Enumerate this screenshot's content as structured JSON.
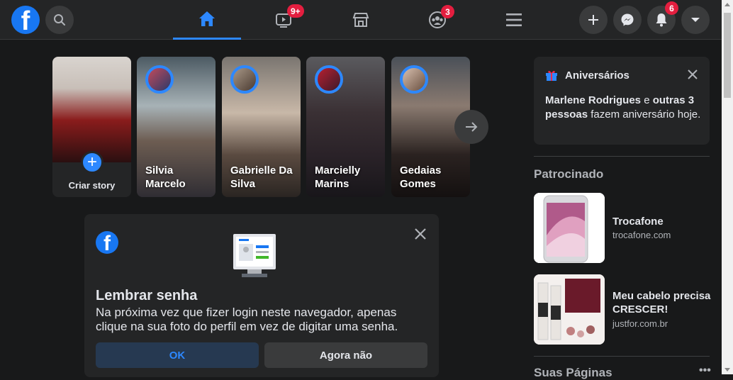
{
  "header": {
    "logo_letter": "f",
    "nav_badges": {
      "watch": "9+",
      "groups": "3"
    },
    "notifications_badge": "6"
  },
  "stories": {
    "create_label": "Criar story",
    "items": [
      {
        "name": "Silvia Marcelo"
      },
      {
        "name": "Gabrielle Da Silva"
      },
      {
        "name": "Marcielly Marins"
      },
      {
        "name": "Gedaias Gomes"
      }
    ]
  },
  "remember_password": {
    "logo_letter": "f",
    "title": "Lembrar senha",
    "description": "Na próxima vez que fizer login neste navegador, apenas clique na sua foto do perfil em vez de digitar uma senha.",
    "ok_label": "OK",
    "later_label": "Agora não"
  },
  "birthdays": {
    "title": "Aniversários",
    "names": "Marlene Rodrigues",
    "connector": " e ",
    "others": "outras 3 pessoas",
    "suffix": " fazem aniversário hoje."
  },
  "sponsored": {
    "title": "Patrocinado",
    "ads": [
      {
        "title": "Trocafone",
        "url": "trocafone.com"
      },
      {
        "title": "Meu cabelo precisa CRESCER!",
        "url": "justfor.com.br"
      }
    ]
  },
  "pages_section": {
    "title": "Suas Páginas"
  },
  "colors": {
    "accent": "#2d88ff",
    "badge": "#e41e3f",
    "surface": "#242526",
    "background": "#18191a"
  }
}
